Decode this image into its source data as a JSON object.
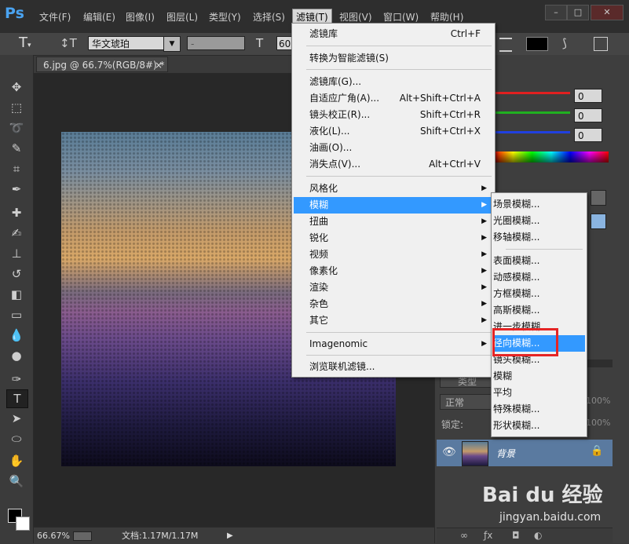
{
  "app": {
    "logo": "Ps"
  },
  "menubar": {
    "items": [
      "文件(F)",
      "编辑(E)",
      "图像(I)",
      "图层(L)",
      "类型(Y)",
      "选择(S)",
      "滤镜(T)",
      "视图(V)",
      "窗口(W)",
      "帮助(H)"
    ],
    "window_buttons": [
      "–",
      "□",
      "✕"
    ]
  },
  "options": {
    "font_name": "华文琥珀",
    "font_style": "-",
    "font_size": "60"
  },
  "document": {
    "tab_title": "6.jpg @ 66.7%(RGB/8#) *",
    "tab_close": "×",
    "zoom": "66.67%",
    "doc_info": "文档:1.17M/1.17M"
  },
  "color_panel": {
    "r": "0",
    "g": "0",
    "b": "0",
    "colors": {
      "red": "#e02020",
      "green": "#20b020",
      "blue": "#2040e0"
    }
  },
  "layers": {
    "kind_label": "类型",
    "blend_mode": "正常",
    "opacity": "100%",
    "lock_label": "锁定:",
    "fill": "100%",
    "layer_name": "背景"
  },
  "filter_menu": {
    "items": [
      {
        "label": "滤镜库",
        "shortcut": "Ctrl+F",
        "arrow": ""
      },
      {
        "label": "转换为智能滤镜(S)",
        "shortcut": "",
        "arrow": ""
      },
      {
        "label": "滤镜库(G)...",
        "shortcut": "",
        "arrow": ""
      },
      {
        "label": "自适应广角(A)...",
        "shortcut": "Alt+Shift+Ctrl+A",
        "arrow": ""
      },
      {
        "label": "镜头校正(R)...",
        "shortcut": "Shift+Ctrl+R",
        "arrow": ""
      },
      {
        "label": "液化(L)...",
        "shortcut": "Shift+Ctrl+X",
        "arrow": ""
      },
      {
        "label": "油画(O)...",
        "shortcut": "",
        "arrow": ""
      },
      {
        "label": "消失点(V)...",
        "shortcut": "Alt+Ctrl+V",
        "arrow": ""
      },
      {
        "label": "风格化",
        "shortcut": "",
        "arrow": "▶"
      },
      {
        "label": "模糊",
        "shortcut": "",
        "arrow": "▶"
      },
      {
        "label": "扭曲",
        "shortcut": "",
        "arrow": "▶"
      },
      {
        "label": "锐化",
        "shortcut": "",
        "arrow": "▶"
      },
      {
        "label": "视频",
        "shortcut": "",
        "arrow": "▶"
      },
      {
        "label": "像素化",
        "shortcut": "",
        "arrow": "▶"
      },
      {
        "label": "渲染",
        "shortcut": "",
        "arrow": "▶"
      },
      {
        "label": "杂色",
        "shortcut": "",
        "arrow": "▶"
      },
      {
        "label": "其它",
        "shortcut": "",
        "arrow": "▶"
      },
      {
        "label": "Imagenomic",
        "shortcut": "",
        "arrow": "▶"
      },
      {
        "label": "浏览联机滤镜...",
        "shortcut": "",
        "arrow": ""
      }
    ]
  },
  "blur_menu": {
    "items": [
      "场景模糊...",
      "光圈模糊...",
      "移轴模糊...",
      "表面模糊...",
      "动感模糊...",
      "方框模糊...",
      "高斯模糊...",
      "进一步模糊",
      "径向模糊...",
      "镜头模糊...",
      "模糊",
      "平均",
      "特殊模糊...",
      "形状模糊..."
    ]
  },
  "watermark": {
    "brand": "Bai du 经验",
    "url": "jingyan.baidu.com"
  }
}
